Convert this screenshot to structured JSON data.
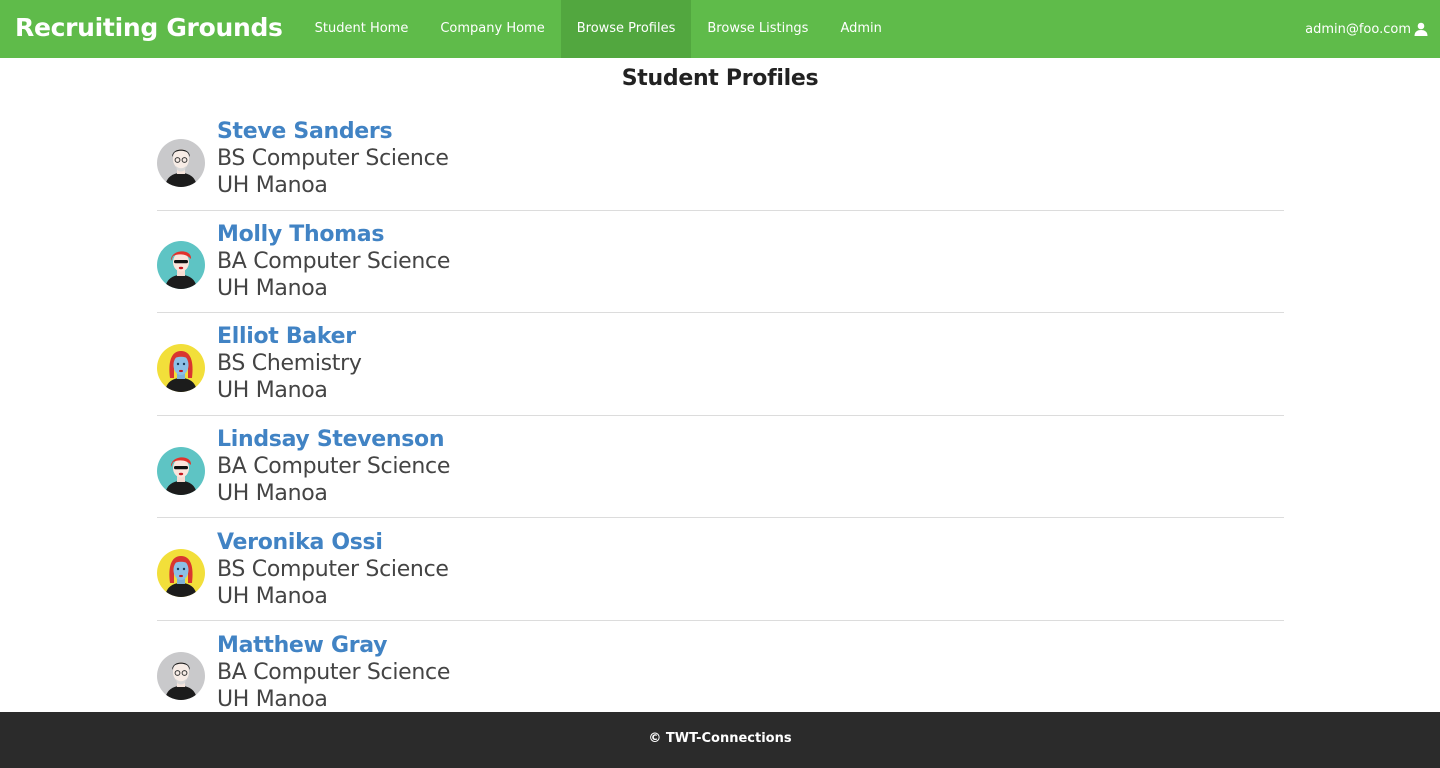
{
  "app": {
    "brand": "Recruiting Grounds",
    "nav": [
      {
        "label": "Student Home",
        "active": false
      },
      {
        "label": "Company Home",
        "active": false
      },
      {
        "label": "Browse Profiles",
        "active": true
      },
      {
        "label": "Browse Listings",
        "active": false
      },
      {
        "label": "Admin",
        "active": false
      }
    ],
    "user": {
      "email": "admin@foo.com",
      "icon": "user-icon"
    }
  },
  "page": {
    "title": "Student Profiles"
  },
  "profiles": [
    {
      "name": "Steve Sanders",
      "degree": "BS Computer Science",
      "school": "UH Manoa",
      "avatar": "gray-male-avatar"
    },
    {
      "name": "Molly Thomas",
      "degree": "BA Computer Science",
      "school": "UH Manoa",
      "avatar": "teal-redhair-avatar"
    },
    {
      "name": "Elliot Baker",
      "degree": "BS Chemistry",
      "school": "UH Manoa",
      "avatar": "yellow-bluehair-avatar"
    },
    {
      "name": "Lindsay Stevenson",
      "degree": "BA Computer Science",
      "school": "UH Manoa",
      "avatar": "teal-redhair-avatar"
    },
    {
      "name": "Veronika Ossi",
      "degree": "BS Computer Science",
      "school": "UH Manoa",
      "avatar": "yellow-bluehair-avatar"
    },
    {
      "name": "Matthew Gray",
      "degree": "BA Computer Science",
      "school": "UH Manoa",
      "avatar": "gray-male-avatar"
    }
  ],
  "footer": {
    "text": "© TWT-Connections"
  },
  "colors": {
    "navbar": "#5fbb4a",
    "navbar_active": "#52a73f",
    "link": "#4183c4",
    "footer": "#2b2b2b"
  }
}
